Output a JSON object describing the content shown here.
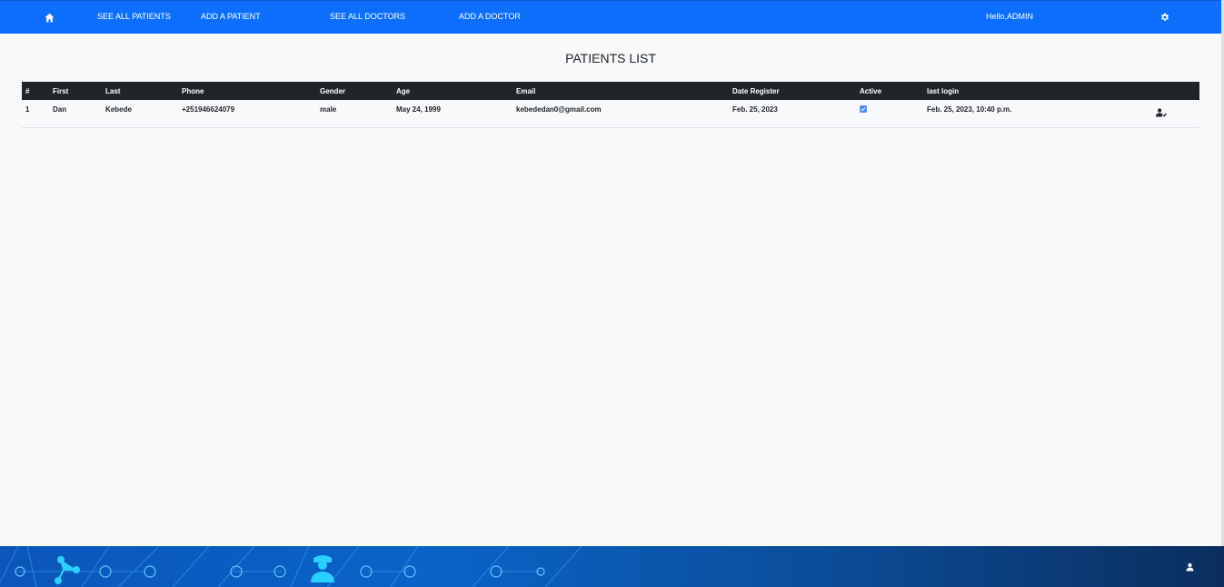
{
  "nav": {
    "home_icon": "home-icon",
    "items": [
      "SEE ALL PATIENTS",
      "ADD A PATIENT",
      "SEE ALL DOCTORS",
      "ADD A DOCTOR"
    ],
    "greeting": "Hello,ADMIN",
    "settings_icon": "gear-icon"
  },
  "page": {
    "title": "PATIENTS LIST"
  },
  "table": {
    "headers": [
      "#",
      "First",
      "Last",
      "Phone",
      "Gender",
      "Age",
      "Email",
      "Date Register",
      "Active",
      "last login"
    ],
    "rows": [
      {
        "num": "1",
        "first": "Dan",
        "last": "Kebede",
        "phone": "+251946624079",
        "gender": "male",
        "age": "May 24, 1999",
        "email": "kebededan0@gmail.com",
        "date_register": "Feb. 25, 2023",
        "active": true,
        "last_login": "Feb. 25, 2023, 10:40 p.m.",
        "action_icon": "user-edit-icon"
      }
    ]
  },
  "footer": {
    "user_icon": "user-icon"
  },
  "colors": {
    "accent": "#0d6efd",
    "header_bg": "#212529",
    "page_bg": "#f8f9fa"
  }
}
